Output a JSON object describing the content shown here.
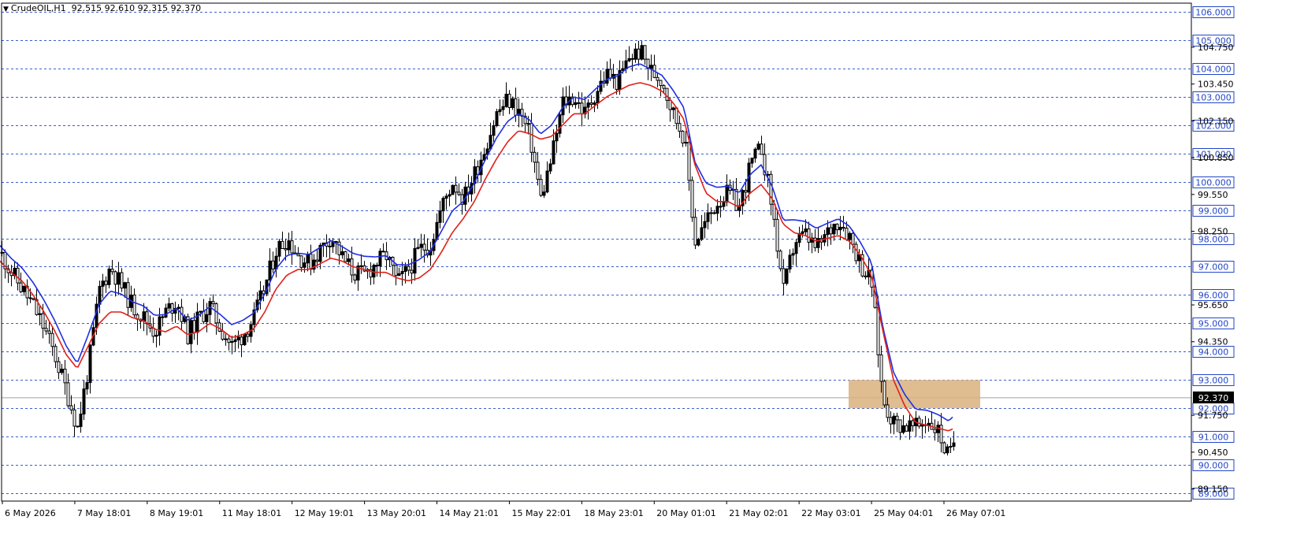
{
  "header": {
    "symbol": "CrudeOIL,H1",
    "ohlc": "92.515 92.610 92.315 92.370"
  },
  "chart_data": {
    "type": "candlestick",
    "title": "",
    "y_range": [
      88.7,
      106.2
    ],
    "price_levels": [
      "106.000",
      "105.000",
      "104.000",
      "103.000",
      "102.000",
      "101.000",
      "100.000",
      "99.000",
      "98.000",
      "97.000",
      "96.000",
      "95.000",
      "94.000",
      "93.000",
      "92.000",
      "91.000",
      "90.000",
      "89.000"
    ],
    "price_ticks": [
      "104.750",
      "103.450",
      "102.150",
      "100.850",
      "99.550",
      "98.250",
      "95.650",
      "94.350",
      "91.750",
      "90.450",
      "89.150"
    ],
    "current_price": "92.370",
    "time_labels": [
      "6 May 2026",
      "7 May 18:01",
      "8 May 19:01",
      "11 May 18:01",
      "12 May 19:01",
      "13 May 20:01",
      "14 May 21:01",
      "15 May 22:01",
      "18 May 23:01",
      "20 May 01:01",
      "21 May 02:01",
      "22 May 03:01",
      "25 May 04:01",
      "26 May 07:01"
    ],
    "close_series": [
      97.5,
      96.8,
      96.2,
      95.6,
      94.8,
      93.8,
      92.6,
      91.3,
      93.5,
      96.2,
      97.0,
      96.3,
      95.6,
      95.2,
      94.7,
      95.4,
      95.8,
      94.6,
      95.2,
      95.6,
      94.8,
      94.2,
      94.6,
      95.2,
      96.3,
      97.6,
      98.0,
      97.4,
      97.1,
      97.6,
      98.1,
      97.3,
      96.8,
      96.7,
      97.1,
      97.4,
      96.4,
      96.9,
      97.6,
      97.8,
      99.1,
      100.0,
      99.4,
      100.3,
      101.3,
      102.4,
      102.9,
      102.5,
      101.6,
      99.4,
      100.9,
      102.8,
      103.0,
      102.4,
      103.2,
      103.8,
      103.5,
      104.4,
      104.6,
      103.9,
      103.6,
      102.4,
      101.6,
      97.9,
      98.6,
      99.3,
      99.6,
      99.1,
      100.6,
      101.2,
      99.0,
      96.1,
      97.9,
      98.1,
      97.6,
      98.2,
      98.7,
      98.1,
      97.1,
      96.4,
      92.3,
      91.5,
      91.4,
      91.3,
      91.6,
      91.2,
      90.2,
      91.7,
      92.4
    ],
    "red_ma": [
      97.2,
      96.8,
      96.5,
      96.0,
      95.4,
      94.7,
      93.9,
      93.4,
      94.2,
      95.0,
      95.4,
      95.4,
      95.2,
      95.1,
      94.8,
      94.7,
      94.9,
      94.6,
      94.7,
      95.0,
      94.8,
      94.5,
      94.6,
      94.8,
      95.4,
      96.2,
      96.7,
      96.9,
      96.9,
      97.1,
      97.3,
      97.2,
      97.0,
      96.9,
      96.8,
      96.8,
      96.6,
      96.5,
      96.6,
      96.9,
      97.5,
      98.2,
      98.7,
      99.3,
      100.1,
      100.8,
      101.4,
      101.8,
      101.7,
      101.5,
      101.6,
      102.0,
      102.4,
      102.4,
      102.7,
      103.0,
      103.2,
      103.4,
      103.5,
      103.4,
      103.2,
      102.8,
      102.2,
      100.6,
      99.6,
      99.3,
      99.3,
      99.1,
      99.6,
      99.9,
      99.4,
      98.5,
      98.2,
      98.1,
      97.9,
      98.0,
      98.1,
      97.9,
      97.4,
      96.7,
      94.8,
      93.0,
      92.1,
      91.5,
      91.4,
      91.3,
      91.2,
      91.4,
      91.5
    ]
  }
}
